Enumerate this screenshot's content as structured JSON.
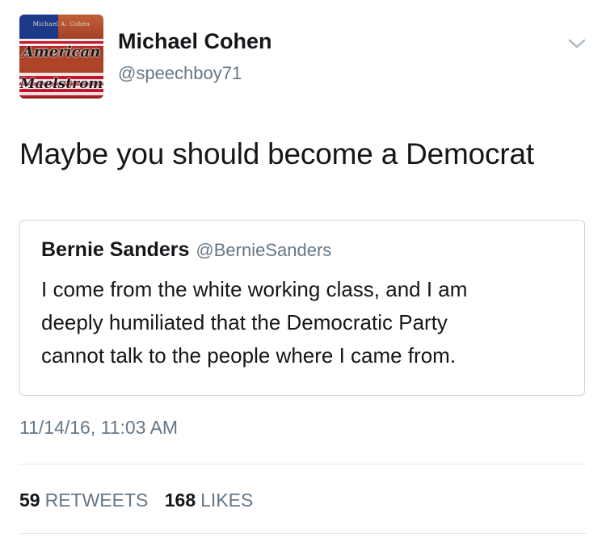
{
  "author": {
    "name": "Michael Cohen",
    "handle": "@speechboy71",
    "avatar": {
      "small_text": "Michael A. Cohen",
      "title_line1": "American",
      "title_line2": "Maelstrom"
    }
  },
  "tweet": {
    "text": "Maybe you should become a Democrat"
  },
  "quoted_tweet": {
    "name": "Bernie Sanders",
    "handle": "@BernieSanders",
    "lines": [
      "I come from the white working class, and I am",
      "deeply humiliated that the Democratic Party",
      "cannot talk to the people where I came from."
    ]
  },
  "meta": {
    "timestamp": "11/14/16, 11:03 AM"
  },
  "stats": {
    "retweets_count": "59",
    "retweets_label": "RETWEETS",
    "likes_count": "168",
    "likes_label": "LIKES"
  },
  "colors": {
    "text": "#14171a",
    "secondary": "#657786",
    "border": "#ccd6dd",
    "divider": "#e1e8ed"
  },
  "icons": {
    "menu": "chevron-down-icon"
  }
}
